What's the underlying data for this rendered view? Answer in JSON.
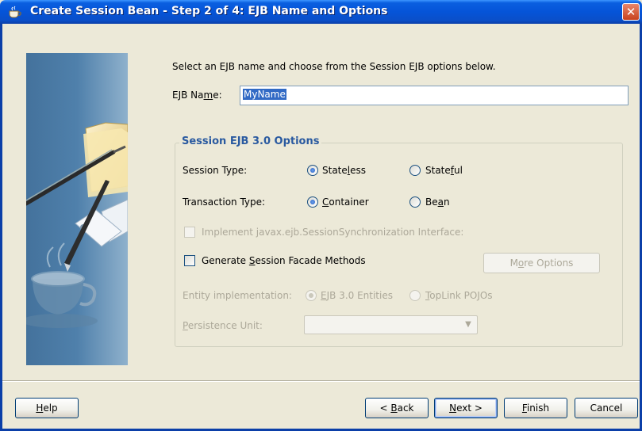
{
  "window": {
    "title": "Create Session Bean - Step 2 of 4: EJB Name and Options",
    "close_glyph": "✕"
  },
  "main": {
    "instruction": "Select an EJB name and choose from the Session EJB options below.",
    "ejb_name_label_pre": "EJB Na",
    "ejb_name_label_mn": "m",
    "ejb_name_label_post": "e:",
    "ejb_name_value": "MyName"
  },
  "options": {
    "group_title": "Session EJB 3.0 Options",
    "session_type_label": "Session Type:",
    "stateless_pre": "State",
    "stateless_mn": "l",
    "stateless_post": "ess",
    "stateful_pre": "State",
    "stateful_mn": "f",
    "stateful_post": "ul",
    "transaction_type_label": "Transaction Type:",
    "container_pre": "",
    "container_mn": "C",
    "container_post": "ontainer",
    "bean_pre": "Be",
    "bean_mn": "a",
    "bean_post": "n",
    "session_sync_label": "Implement javax.ejb.SessionSynchronization Interface:",
    "facade_pre": "Generate ",
    "facade_mn": "S",
    "facade_post": "ession Facade Methods",
    "more_options_pre": "M",
    "more_options_mn": "o",
    "more_options_post": "re Options",
    "entity_impl_label": "Entity implementation:",
    "ejb30_pre": "",
    "ejb30_mn": "E",
    "ejb30_post": "JB 3.0 Entities",
    "toplink_pre": "",
    "toplink_mn": "T",
    "toplink_post": "opLink POJOs",
    "persistence_pre": "",
    "persistence_mn": "P",
    "persistence_post": "ersistence Unit:",
    "persistence_value": ""
  },
  "footer": {
    "help_mn": "H",
    "help_post": "elp",
    "back_pre": "< ",
    "back_mn": "B",
    "back_post": "ack",
    "next_mn": "N",
    "next_post": "ext >",
    "finish_mn": "F",
    "finish_post": "inish",
    "cancel": "Cancel"
  },
  "colors": {
    "title_bar": "#0554d8",
    "group_title": "#2a5aa0",
    "selection": "#316ac5",
    "window_bg": "#ece9d8"
  },
  "icons": [
    "coffee-cup-icon",
    "close-icon",
    "wizard-illustration",
    "chevron-down-icon"
  ]
}
